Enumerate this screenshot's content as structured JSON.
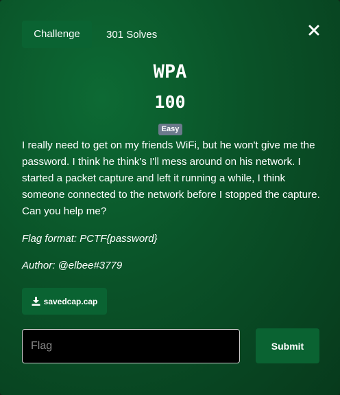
{
  "tabs": {
    "challenge_label": "Challenge",
    "solves_label": "301 Solves"
  },
  "challenge": {
    "name": "WPA",
    "value": "100",
    "difficulty": "Easy",
    "description": "I really need to get on my friends WiFi, but he won't give me the password. I think he think's I'll mess around on his network. I started a packet capture and left it running a while, I think someone connected to the network before I stopped the capture. Can you help me?",
    "flag_format": "Flag format: PCTF{password}",
    "author": "Author: @elbee#3779"
  },
  "files": [
    {
      "name": "savedcap.cap"
    }
  ],
  "submission": {
    "placeholder": "Flag",
    "value": "",
    "submit_label": "Submit"
  },
  "icons": {
    "close": "close-icon",
    "download": "download-icon"
  },
  "colors": {
    "accent": "#0a6332",
    "badge": "#6c7a8c",
    "input_bg": "#000000"
  }
}
